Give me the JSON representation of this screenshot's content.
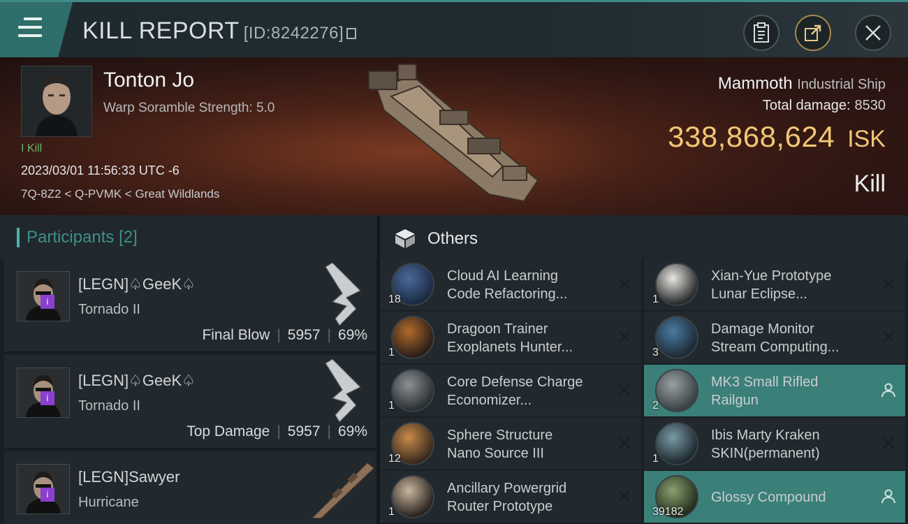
{
  "header": {
    "title": "KILL REPORT",
    "report_id": "[ID:8242276]"
  },
  "victim": {
    "name": "Tonton Jo",
    "subtitle": "Warp Soramble Strength: 5.0",
    "kill_tag": "I Kill",
    "datetime": "2023/03/01 11:56:33 UTC -6",
    "location": "7Q-8Z2 < Q-PVMK < Great Wildlands",
    "ship_name": "Mammoth",
    "ship_class": "Industrial Ship",
    "total_damage_label": "Total damage:",
    "total_damage": "8530",
    "isk_value": "338,868,624",
    "isk_unit": "ISK",
    "result": "Kill"
  },
  "participants": {
    "title": "Participants",
    "count": "[2]",
    "items": [
      {
        "name": "[LEGN]♤GeeK♤",
        "ship": "Tornado II",
        "role": "Final Blow",
        "damage": "5957",
        "pct": "69%"
      },
      {
        "name": "[LEGN]♤GeeK♤",
        "ship": "Tornado II",
        "role": "Top Damage",
        "damage": "5957",
        "pct": "69%"
      },
      {
        "name": "[LEGN]Sawyer",
        "ship": "Hurricane",
        "role": "",
        "damage": "",
        "pct": ""
      }
    ]
  },
  "others": {
    "title": "Others",
    "items": [
      {
        "qty": "18",
        "name": "Cloud AI Learning\nCode Refactoring...",
        "action": "close"
      },
      {
        "qty": "1",
        "name": "Xian-Yue Prototype\nLunar Eclipse...",
        "action": "close"
      },
      {
        "qty": "1",
        "name": "Dragoon Trainer\nExoplanets Hunter...",
        "action": "close"
      },
      {
        "qty": "3",
        "name": "Damage Monitor\nStream Computing...",
        "action": "close"
      },
      {
        "qty": "1",
        "name": "Core Defense Charge\nEconomizer...",
        "action": "close"
      },
      {
        "qty": "2",
        "name": "MK3 Small Rifled\nRailgun",
        "action": "person",
        "highlight": true
      },
      {
        "qty": "12",
        "name": "Sphere Structure\nNano Source III",
        "action": "close"
      },
      {
        "qty": "1",
        "name": "Ibis Marty Kraken\nSKIN(permanent)",
        "action": "close"
      },
      {
        "qty": "1",
        "name": "Ancillary Powergrid\nRouter Prototype",
        "action": "close"
      },
      {
        "qty": "39182",
        "name": "Glossy Compound",
        "action": "person",
        "highlight": true
      }
    ]
  },
  "colors": {
    "accent": "#3f8c86",
    "isk": "#f3c674",
    "highlight_row": "#3b7f79",
    "badge": "#8a3fcf"
  }
}
